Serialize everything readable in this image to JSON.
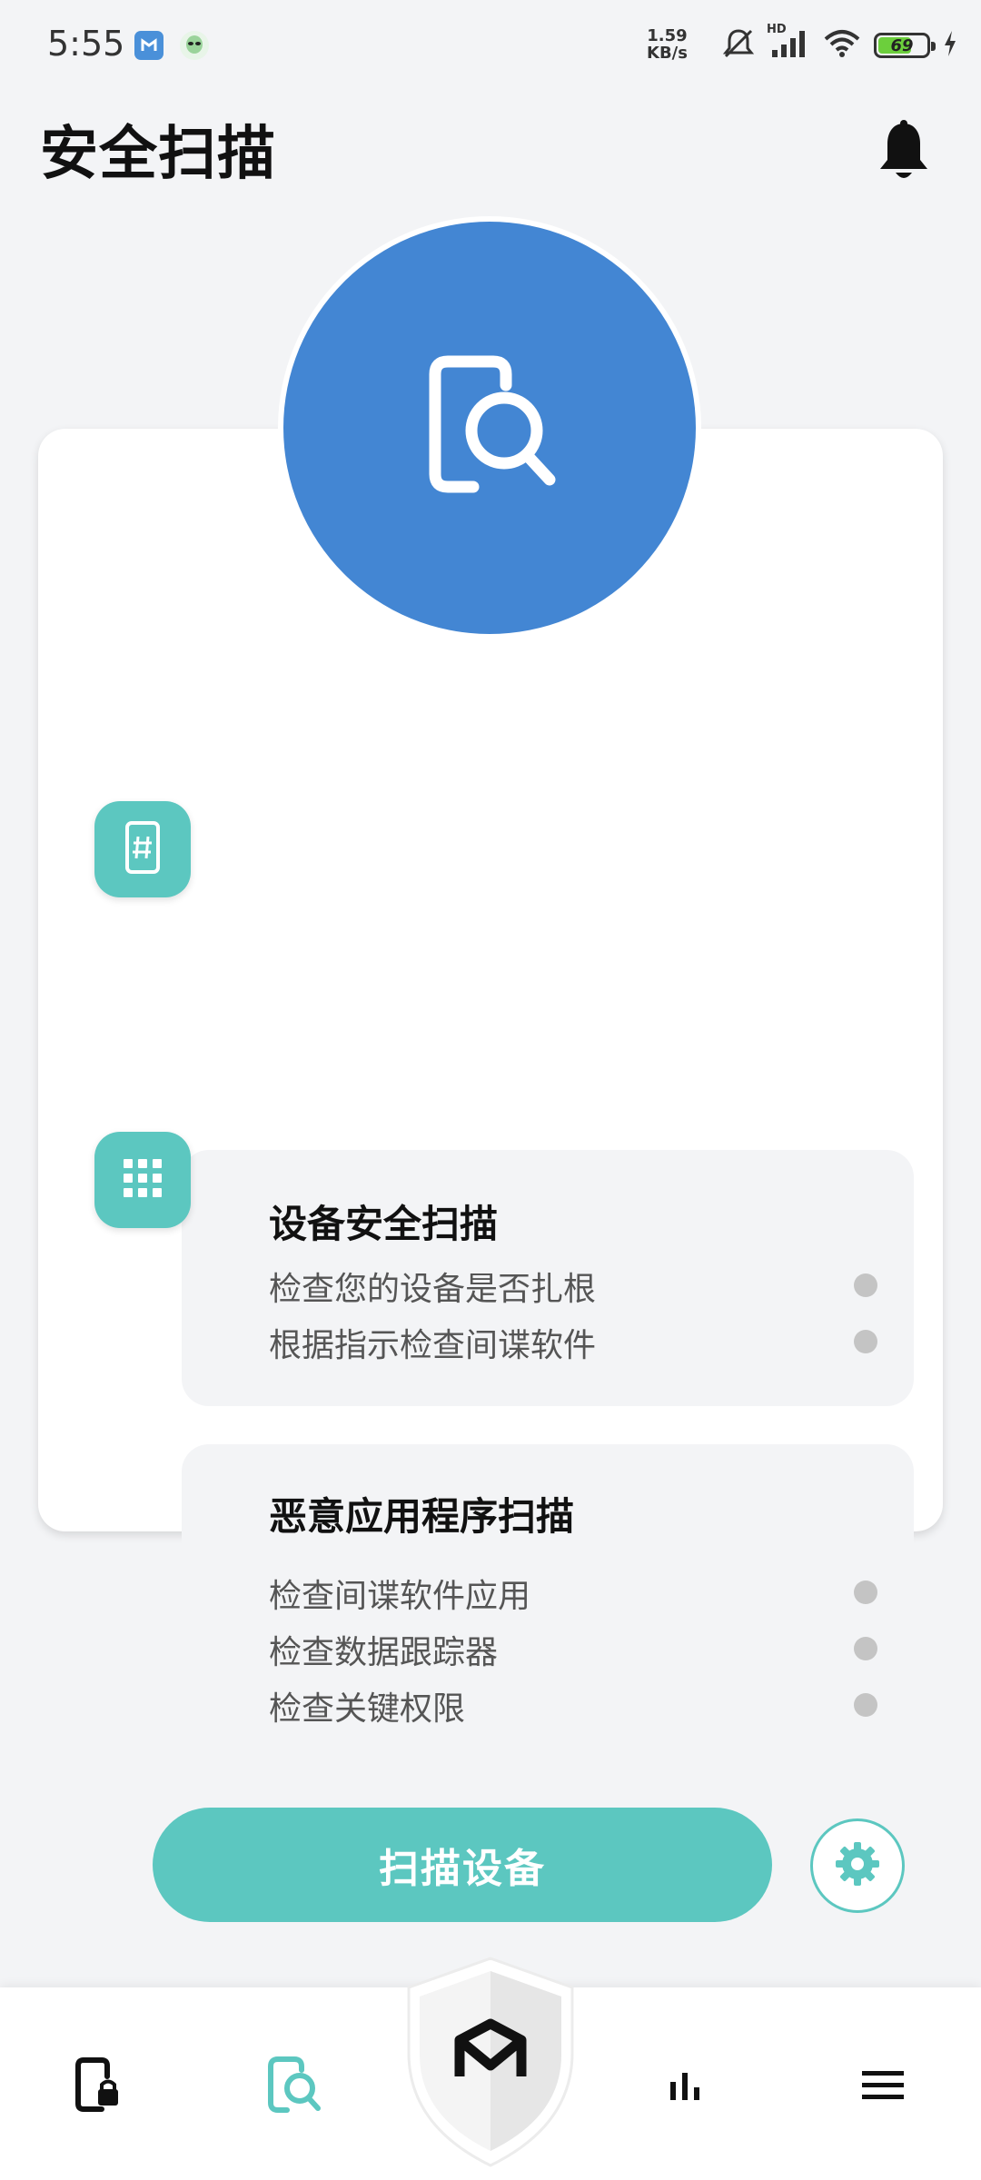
{
  "status_bar": {
    "time": "5:55",
    "speed_value": "1.59",
    "speed_unit": "KB/s",
    "network_label": "HD",
    "battery": "69",
    "battery_level": 0.69,
    "icons": [
      "app-shield-icon",
      "app-alien-icon",
      "mute-icon",
      "signal-icon",
      "wifi-icon",
      "battery-icon",
      "charging-icon"
    ]
  },
  "header": {
    "title": "安全扫描",
    "notification_icon": "bell-icon"
  },
  "hero": {
    "icon": "device-search-icon",
    "color": "#4386d3"
  },
  "sections": [
    {
      "title": "设备安全扫描",
      "icon": "phone-hash-icon",
      "items": [
        {
          "label": "检查您的设备是否扎根"
        },
        {
          "label": "根据指示检查间谍软件"
        }
      ]
    },
    {
      "title": "恶意应用程序扫描",
      "icon": "app-grid-icon",
      "items": [
        {
          "label": "检查间谍软件应用"
        },
        {
          "label": "检查数据跟踪器"
        },
        {
          "label": "检查关键权限"
        }
      ]
    }
  ],
  "actions": {
    "scan_label": "扫描设备",
    "settings_icon": "gear-icon",
    "accent": "#5cc7c0"
  },
  "bottom_nav": {
    "items": [
      {
        "icon": "phone-lock-icon",
        "active": false
      },
      {
        "icon": "device-search-icon",
        "active": true
      },
      {
        "icon": "shield-logo-icon",
        "active": false
      },
      {
        "icon": "bar-chart-icon",
        "active": false
      },
      {
        "icon": "menu-icon",
        "active": false
      }
    ]
  }
}
